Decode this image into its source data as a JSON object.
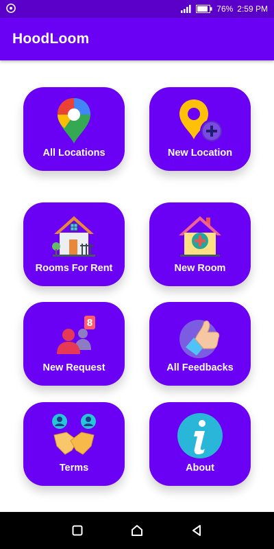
{
  "status": {
    "battery": "76%",
    "time": "2:59 PM"
  },
  "app_bar": {
    "title": "HoodLoom"
  },
  "tiles": [
    {
      "label": "All Locations",
      "icon": "map-pin-icon"
    },
    {
      "label": "New Location",
      "icon": "add-location-icon"
    },
    {
      "label": "Rooms For Rent",
      "icon": "house-icon"
    },
    {
      "label": "New Room",
      "icon": "add-house-icon"
    },
    {
      "label": "New Request",
      "icon": "requests-icon",
      "badge": "8"
    },
    {
      "label": "All Feedbacks",
      "icon": "thumbs-up-icon"
    },
    {
      "label": "Terms",
      "icon": "handshake-icon"
    },
    {
      "label": "About",
      "icon": "info-icon"
    }
  ],
  "colors": {
    "status_bar": "#5a00c8",
    "app_bar": "#6a00f4",
    "tile": "#6a00f4"
  },
  "nav": {
    "recents": "recents-square-icon",
    "home": "home-circle-icon",
    "back": "back-triangle-icon"
  }
}
